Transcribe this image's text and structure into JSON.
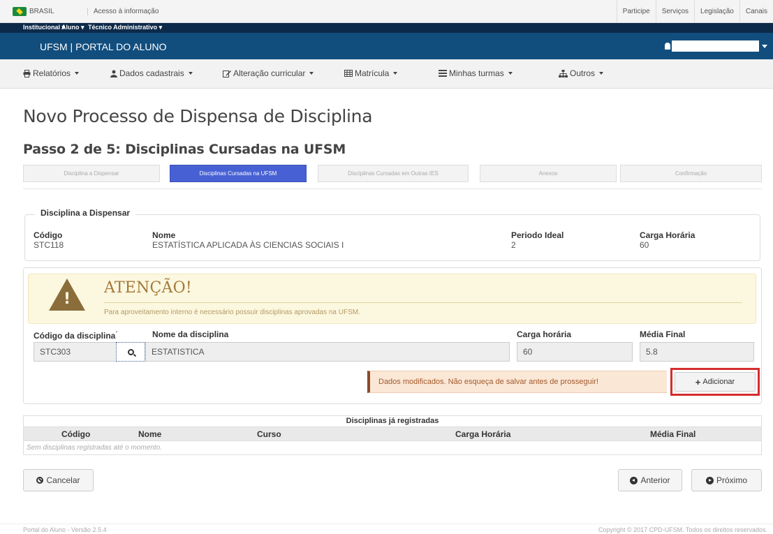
{
  "gov_bar": {
    "brasil": "BRASIL",
    "acesso": "Acesso à informação",
    "links": [
      "Participe",
      "Serviços",
      "Legislação",
      "Canais"
    ]
  },
  "inst_bar": {
    "items": [
      "Institucional ▾",
      "Aluno ▾",
      "Técnico Administrativo ▾"
    ]
  },
  "portal": {
    "title": "UFSM | PORTAL DO ALUNO"
  },
  "menu": [
    {
      "label": "Relatórios",
      "icon": "print-icon"
    },
    {
      "label": "Dados cadastrais",
      "icon": "user-icon"
    },
    {
      "label": "Alteração curricular",
      "icon": "edit-icon"
    },
    {
      "label": "Matrícula",
      "icon": "table-icon"
    },
    {
      "label": "Minhas turmas",
      "icon": "list-icon"
    },
    {
      "label": "Outros",
      "icon": "sitemap-icon"
    }
  ],
  "page": {
    "title": "Novo Processo de Dispensa de Disciplina",
    "subtitle": "Passo 2 de 5: Disciplinas Cursadas na UFSM"
  },
  "steps": [
    "Disciplina a Dispensar",
    "Disciplinas Cursadas na UFSM",
    "Disciplinas Cursadas em Outras IES",
    "Anexos",
    "Confirmação"
  ],
  "dispensar": {
    "legend": "Disciplina a Dispensar",
    "codigo_label": "Código",
    "codigo": "STC118",
    "nome_label": "Nome",
    "nome": "ESTATÍSTICA APLICADA ÀS CIENCIAS SOCIAIS I",
    "periodo_label": "Periodo Ideal",
    "periodo": "2",
    "carga_label": "Carga Horária",
    "carga": "60"
  },
  "alert": {
    "title": "ATENÇÃO!",
    "text": "Para aproveitamento interno é necessário possuir disciplinas aprovadas na UFSM."
  },
  "form": {
    "codigo_label": "Código da disciplina",
    "required_mark": "*",
    "codigo_value": "STC303",
    "nome_label": "Nome da disciplina",
    "nome_value": "ESTATISTICA",
    "carga_label": "Carga horária",
    "carga_value": "60",
    "media_label": "Média Final",
    "media_value": "5.8"
  },
  "notice": "Dados modificados. Não esqueça de salvar antes de prosseguir!",
  "add_button": "Adicionar",
  "table": {
    "title": "Disciplinas já registradas",
    "columns": [
      "Código",
      "Nome",
      "Curso",
      "Carga Horária",
      "Média Final"
    ],
    "empty": "Sem disciplinas registradas até o momento."
  },
  "buttons": {
    "cancel": "Cancelar",
    "previous": "Anterior",
    "next": "Próximo"
  },
  "footer": {
    "left": "Portal do Aluno - Versão 2.5.4",
    "right": "Copyright © 2017 CPD-UFSM. Todos os direitos reservados."
  }
}
